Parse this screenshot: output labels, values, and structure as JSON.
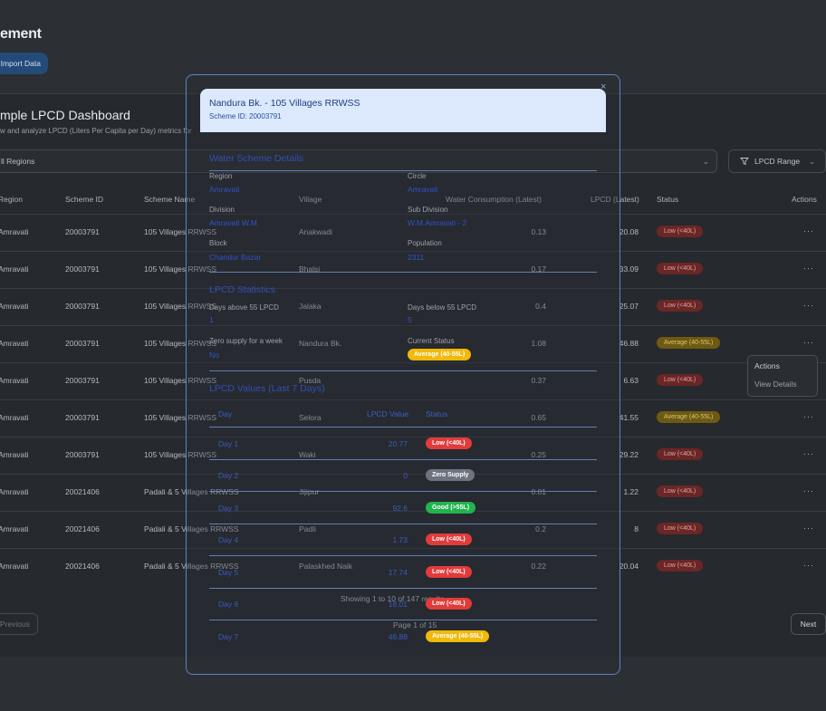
{
  "page": {
    "title": "ement",
    "import_button": "Import Data"
  },
  "dashboard": {
    "title": "mple LPCD Dashboard",
    "subtitle": "w and analyze LPCD (Liters Per Capita per Day) metrics for",
    "region_filter": "ll Regions",
    "lpcd_range": "LPCD Range"
  },
  "table": {
    "headers": [
      "Region",
      "Scheme ID",
      "Scheme Name",
      "Village",
      "Water Consumption (Latest)",
      "LPCD (Latest)",
      "Status",
      "Actions"
    ],
    "rows": [
      {
        "region": "Amravati",
        "scheme_id": "20003791",
        "scheme_name": "105 Villages RRWSS",
        "village": "Anakwadi",
        "consumption": "0.13",
        "lpcd": "20.08",
        "status": "Low (<40L)",
        "status_type": "low"
      },
      {
        "region": "Amravati",
        "scheme_id": "20003791",
        "scheme_name": "105 Villages RRWSS",
        "village": "Bhalsi",
        "consumption": "0.17",
        "lpcd": "33.09",
        "status": "Low (<40L)",
        "status_type": "low"
      },
      {
        "region": "Amravati",
        "scheme_id": "20003791",
        "scheme_name": "105 Villages RRWSS",
        "village": "Jalaka",
        "consumption": "0.4",
        "lpcd": "25.07",
        "status": "Low (<40L)",
        "status_type": "low"
      },
      {
        "region": "Amravati",
        "scheme_id": "20003791",
        "scheme_name": "105 Villages RRWSS",
        "village": "Nandura Bk.",
        "consumption": "1.08",
        "lpcd": "46.88",
        "status": "Average (40-55L)",
        "status_type": "avg"
      },
      {
        "region": "Amravati",
        "scheme_id": "20003791",
        "scheme_name": "105 Villages RRWSS",
        "village": "Pusda",
        "consumption": "0.37",
        "lpcd": "6.63",
        "status": "Low (<40L)",
        "status_type": "low"
      },
      {
        "region": "Amravati",
        "scheme_id": "20003791",
        "scheme_name": "105 Villages RRWSS",
        "village": "Selora",
        "consumption": "0.65",
        "lpcd": "41.55",
        "status": "Average (40-55L)",
        "status_type": "avg"
      },
      {
        "region": "Amravati",
        "scheme_id": "20003791",
        "scheme_name": "105 Villages RRWSS",
        "village": "Waki",
        "consumption": "0.25",
        "lpcd": "29.22",
        "status": "Low (<40L)",
        "status_type": "low"
      },
      {
        "region": "Amravati",
        "scheme_id": "20021406",
        "scheme_name": "Padali & 5 Villages RRWSS",
        "village": "Jijipur",
        "consumption": "0.01",
        "lpcd": "1.22",
        "status": "Low (<40L)",
        "status_type": "low"
      },
      {
        "region": "Amravati",
        "scheme_id": "20021406",
        "scheme_name": "Padali & 5 Villages RRWSS",
        "village": "Padli",
        "consumption": "0.2",
        "lpcd": "8",
        "status": "Low (<40L)",
        "status_type": "low"
      },
      {
        "region": "Amravati",
        "scheme_id": "20021406",
        "scheme_name": "Padali & 5 Villages RRWSS",
        "village": "Palaskhed Naik",
        "consumption": "0.22",
        "lpcd": "20.04",
        "status": "Low (<40L)",
        "status_type": "low"
      }
    ],
    "row_actions": "···"
  },
  "actions_menu": {
    "title": "Actions",
    "view_details": "View Details"
  },
  "pagination": {
    "info": "Showing 1 to 10 of 147 results",
    "page": "Page 1 of 15",
    "previous": "Previous",
    "next": "Next"
  },
  "modal": {
    "close": "×",
    "title": "Nandura Bk. - 105 Villages RRWSS",
    "scheme_id": "Scheme ID: 20003791",
    "details_heading": "Water Scheme Details",
    "region_label": "Region",
    "region_value": "Amravati",
    "circle_label": "Circle",
    "circle_value": "Amravati",
    "division_label": "Division",
    "division_value": "Amravati W.M",
    "subdivision_label": "Sub Division",
    "subdivision_value": "W.M.Amravati - 2",
    "block_label": "Block",
    "block_value": "Chandur Bazar",
    "population_label": "Population",
    "population_value": "2311",
    "stats_heading": "LPCD Statistics",
    "days_above_label": "Days above 55 LPCD",
    "days_above_value": "1",
    "days_below_label": "Days below 55 LPCD",
    "days_below_value": "5",
    "zero_supply_label": "Zero supply for a week",
    "zero_supply_value": "No",
    "current_status_label": "Current Status",
    "current_status_value": "Average (40-55L)",
    "values_heading": "LPCD Values (Last 7 Days)",
    "col_day": "Day",
    "col_value": "LPCD Value",
    "col_status": "Status",
    "days": [
      {
        "day": "Day 1",
        "value": "20.77",
        "status": "Low (<40L)",
        "type": "low"
      },
      {
        "day": "Day 2",
        "value": "0",
        "status": "Zero Supply",
        "type": "zero"
      },
      {
        "day": "Day 3",
        "value": "92.6",
        "status": "Good (>55L)",
        "type": "good"
      },
      {
        "day": "Day 4",
        "value": "1.73",
        "status": "Low (<40L)",
        "type": "low"
      },
      {
        "day": "Day 5",
        "value": "17.74",
        "status": "Low (<40L)",
        "type": "low"
      },
      {
        "day": "Day 6",
        "value": "18.01",
        "status": "Low (<40L)",
        "type": "low"
      },
      {
        "day": "Day 7",
        "value": "46.88",
        "status": "Average (40-55L)",
        "type": "avg"
      }
    ]
  }
}
